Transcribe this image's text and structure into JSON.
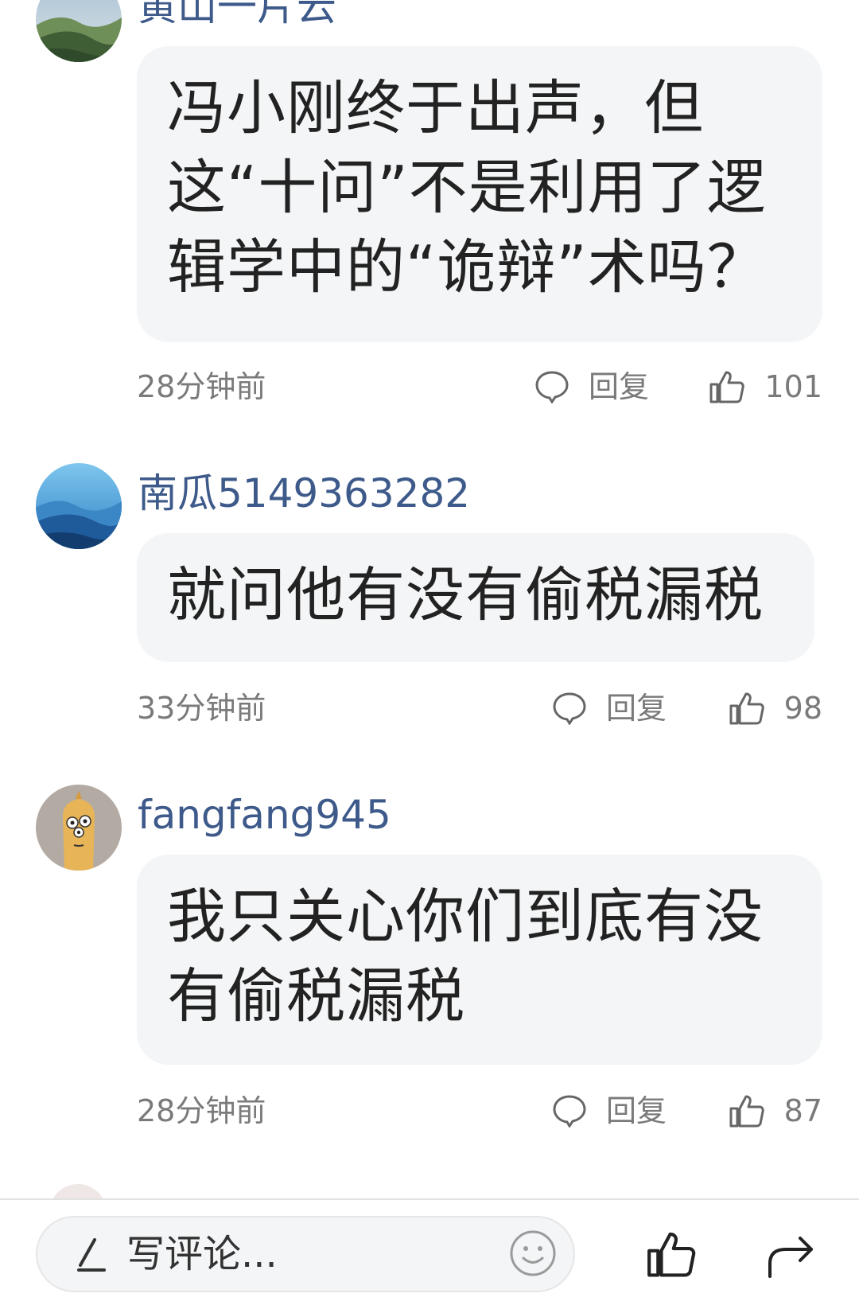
{
  "comments": [
    {
      "username": "黄山一片云",
      "text": "冯小刚终于出声，但这“十问”不是利用了逻辑学中的“诡辩”术吗？",
      "time": "28分钟前",
      "reply_label": "回复",
      "likes": "101"
    },
    {
      "username": "南瓜5149363282",
      "text": "就问他有没有偷税漏税",
      "time": "33分钟前",
      "reply_label": "回复",
      "likes": "98"
    },
    {
      "username": "fangfang945",
      "text": "我只关心你们到底有没有偷税漏税",
      "time": "28分钟前",
      "reply_label": "回复",
      "likes": "87"
    }
  ],
  "bottom_bar": {
    "placeholder": "写评论...",
    "icons": {
      "pen": "pencil-icon",
      "emoji": "smiley-icon",
      "like": "thumbs-up-icon",
      "share": "share-arrow-icon"
    }
  },
  "colors": {
    "username": "#3d5a8a",
    "bubble_bg": "#f4f5f6",
    "meta_text": "#7a7a7a"
  }
}
